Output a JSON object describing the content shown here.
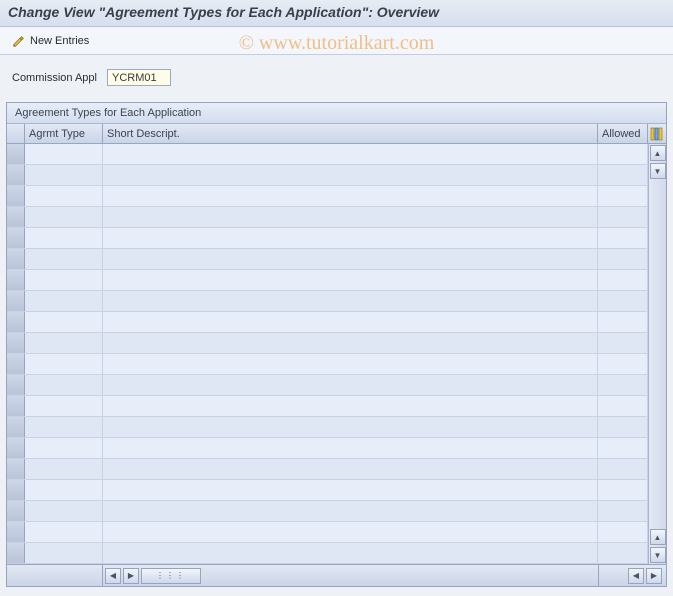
{
  "header": {
    "title": "Change View \"Agreement Types for Each Application\": Overview"
  },
  "toolbar": {
    "new_entries_label": "New Entries"
  },
  "form": {
    "commission_appl_label": "Commission Appl",
    "commission_appl_value": "YCRM01"
  },
  "grid": {
    "title": "Agreement Types for Each Application",
    "columns": {
      "agrmt_type": "Agrmt Type",
      "short_descript": "Short Descript.",
      "allowed": "Allowed"
    },
    "rows": [
      {
        "agrmt_type": "",
        "short_descript": "",
        "allowed": ""
      },
      {
        "agrmt_type": "",
        "short_descript": "",
        "allowed": ""
      },
      {
        "agrmt_type": "",
        "short_descript": "",
        "allowed": ""
      },
      {
        "agrmt_type": "",
        "short_descript": "",
        "allowed": ""
      },
      {
        "agrmt_type": "",
        "short_descript": "",
        "allowed": ""
      },
      {
        "agrmt_type": "",
        "short_descript": "",
        "allowed": ""
      },
      {
        "agrmt_type": "",
        "short_descript": "",
        "allowed": ""
      },
      {
        "agrmt_type": "",
        "short_descript": "",
        "allowed": ""
      },
      {
        "agrmt_type": "",
        "short_descript": "",
        "allowed": ""
      },
      {
        "agrmt_type": "",
        "short_descript": "",
        "allowed": ""
      },
      {
        "agrmt_type": "",
        "short_descript": "",
        "allowed": ""
      },
      {
        "agrmt_type": "",
        "short_descript": "",
        "allowed": ""
      },
      {
        "agrmt_type": "",
        "short_descript": "",
        "allowed": ""
      },
      {
        "agrmt_type": "",
        "short_descript": "",
        "allowed": ""
      },
      {
        "agrmt_type": "",
        "short_descript": "",
        "allowed": ""
      },
      {
        "agrmt_type": "",
        "short_descript": "",
        "allowed": ""
      },
      {
        "agrmt_type": "",
        "short_descript": "",
        "allowed": ""
      },
      {
        "agrmt_type": "",
        "short_descript": "",
        "allowed": ""
      },
      {
        "agrmt_type": "",
        "short_descript": "",
        "allowed": ""
      },
      {
        "agrmt_type": "",
        "short_descript": "",
        "allowed": ""
      }
    ]
  },
  "watermark": "© www.tutorialkart.com"
}
